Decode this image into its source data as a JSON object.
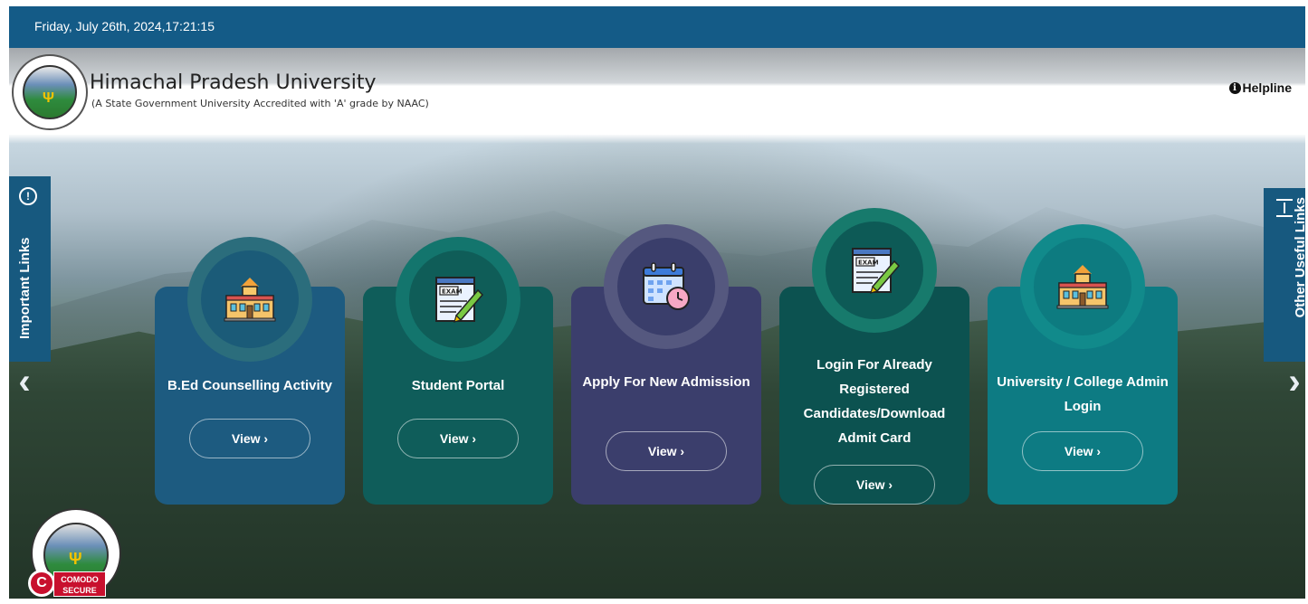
{
  "topbar": {
    "datetime": "Friday, July 26th, 2024,17:21:15"
  },
  "header": {
    "university_name": "Himachal Pradesh University",
    "subtitle": "(A State Government University Accredited with 'A' grade by NAAC)",
    "helpline_label": "Helpline",
    "logo": "himachal-pradesh-university-emblem"
  },
  "side_tabs": {
    "left_label": "Important Links",
    "right_label": "Other Useful Links"
  },
  "cards": [
    {
      "title": "B.Ed Counselling Activity",
      "button": "View ›",
      "icon": "university-building-icon"
    },
    {
      "title": "Student Portal",
      "button": "View ›",
      "icon": "exam-paper-icon"
    },
    {
      "title": "Apply For New Admission",
      "button": "View ›",
      "icon": "calendar-clock-icon"
    },
    {
      "title": "Login For Already Registered Candidates/Download Admit Card",
      "button": "View ›",
      "icon": "exam-paper-icon"
    },
    {
      "title": "University / College Admin Login",
      "button": "View ›",
      "icon": "university-building-icon"
    }
  ],
  "security_badge": {
    "text": "COMODO SECURE",
    "letter": "C"
  },
  "colors": {
    "topbar": "#145b87",
    "card_1": "#1d5b80",
    "card_2": "#0f5d5a",
    "card_3": "#3b3e6c",
    "card_4": "#0c5250",
    "card_5": "#0d7b83"
  }
}
